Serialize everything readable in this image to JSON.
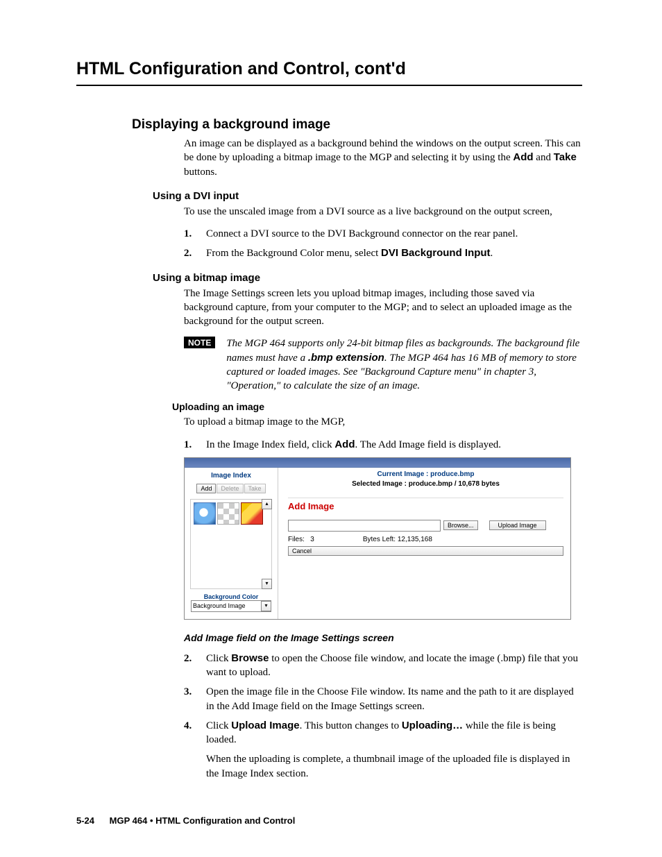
{
  "page_title": "HTML Configuration and Control, cont'd",
  "h2_display": "Displaying a background image",
  "p_intro_1": "An image can be displayed as a background behind the windows on the output screen.  This can be done by uploading a bitmap image to the MGP and selecting it by using the ",
  "add_lbl": "Add",
  "and_word": " and ",
  "take_lbl": "Take",
  "p_intro_2": " buttons.",
  "h3_dvi": "Using a DVI input",
  "p_dvi": "To use the unscaled image from a DVI source as a live background on the output screen,",
  "dvi_step1": "Connect a DVI source to the DVI Background connector on the rear panel.",
  "dvi_step2a": "From the Background Color menu, select ",
  "dvi_step2b": "DVI Background Input",
  "dvi_step2c": ".",
  "h3_bmp": "Using a bitmap image",
  "p_bmp": "The Image Settings screen lets you upload bitmap images, including those saved via background capture, from your computer to the MGP; and to select an uploaded image as the background for the output screen.",
  "note_label": "NOTE",
  "note_a": "The MGP 464 supports only 24-bit bitmap files as backgrounds.  The background file names must have a ",
  "note_ext": ".bmp extension",
  "note_b": ".  The MGP 464 has 16 MB of memory to store captured or loaded images.  See \"Background Capture menu\" in chapter 3, \"Operation,\" to calculate the size of an image.",
  "h4_upload": "Uploading an image",
  "p_upload": "To upload a bitmap image to the MGP,",
  "up1a": "In the Image Index field, click ",
  "up1b": "Add",
  "up1c": ".  The Add Image field is displayed.",
  "fig": {
    "image_index": "Image Index",
    "add": "Add",
    "delete": "Delete",
    "take": "Take",
    "bg_color": "Background Color",
    "bg_sel": "Background Image",
    "cur": "Current Image : produce.bmp",
    "sel": "Selected Image : produce.bmp / 10,678 bytes",
    "add_image": "Add Image",
    "browse": "Browse...",
    "upload": "Upload Image",
    "files_label": "Files:",
    "files_count": "3",
    "bytes_left_label": "Bytes Left:",
    "bytes_left": "12,135,168",
    "cancel": "Cancel"
  },
  "caption": "Add Image field on the Image Settings screen",
  "n2": "2",
  "n3": "3",
  "n4": "4",
  "n1": "1",
  "step2a": "Click ",
  "step2b": "Browse",
  "step2c": " to open the Choose file window, and locate the image (.bmp) file that you want to upload.",
  "step3": "Open the image file in the Choose File window.  Its name and the path to it are displayed in the Add Image field on the Image Settings screen.",
  "step4a": "Click ",
  "step4b": "Upload Image",
  "step4c": ".  This button changes to ",
  "step4d": "Uploading…",
  "step4e": " while the file is being loaded.",
  "step4f": "When the uploading is complete, a thumbnail image of the uploaded file is displayed in the Image Index section.",
  "footer_page": "5-24",
  "footer_sect": "MGP 464 • HTML Configuration and Control"
}
